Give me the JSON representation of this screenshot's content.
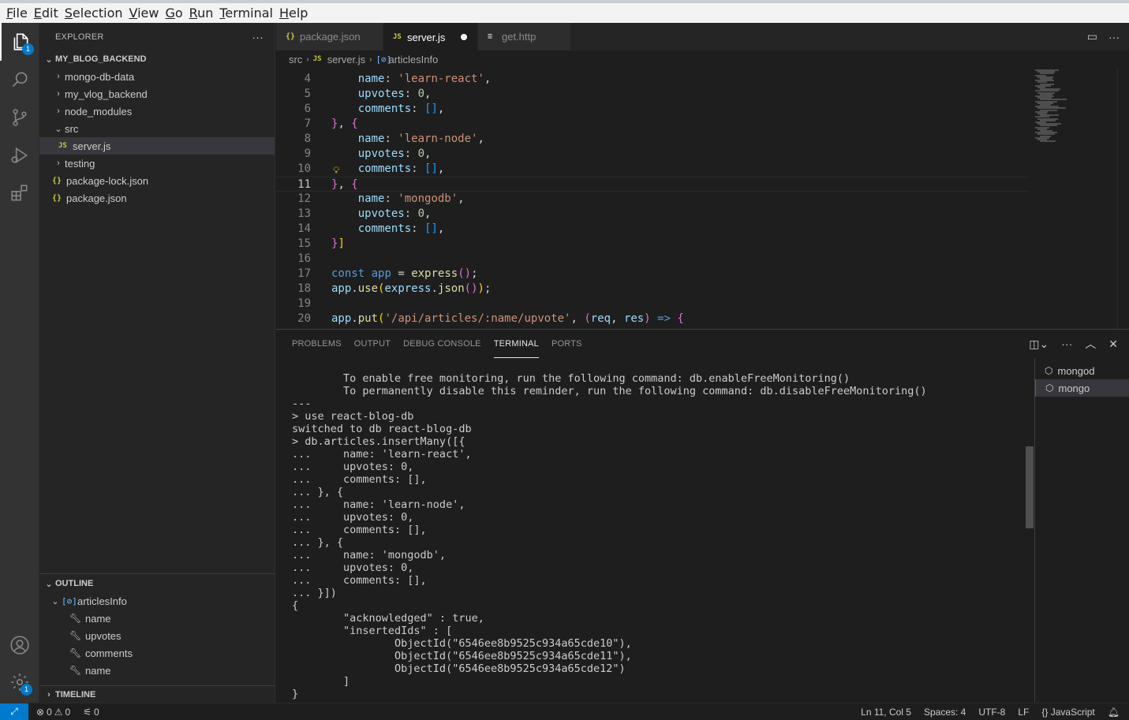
{
  "menu": [
    "File",
    "Edit",
    "Selection",
    "View",
    "Go",
    "Run",
    "Terminal",
    "Help"
  ],
  "activity": {
    "explorer_badge": "1",
    "settings_badge": "1"
  },
  "explorer": {
    "title": "EXPLORER",
    "more": "···",
    "root": "MY_BLOG_BACKEND",
    "items": [
      {
        "label": "mongo-db-data",
        "kind": "folder"
      },
      {
        "label": "my_vlog_backend",
        "kind": "folder"
      },
      {
        "label": "node_modules",
        "kind": "folder"
      },
      {
        "label": "src",
        "kind": "folder-open"
      },
      {
        "label": "server.js",
        "kind": "js"
      },
      {
        "label": "testing",
        "kind": "folder"
      },
      {
        "label": "package-lock.json",
        "kind": "json"
      },
      {
        "label": "package.json",
        "kind": "json"
      }
    ]
  },
  "outline": {
    "title": "OUTLINE",
    "root": "articlesInfo",
    "items": [
      "name",
      "upvotes",
      "comments",
      "name"
    ]
  },
  "timeline": {
    "title": "TIMELINE"
  },
  "tabs": [
    {
      "label": "package.json",
      "icon": "{}"
    },
    {
      "label": "server.js",
      "icon": "JS"
    },
    {
      "label": "get.http",
      "icon": "≡"
    }
  ],
  "breadcrumb": {
    "folder": "src",
    "file": "server.js",
    "symbol": "articlesInfo",
    "file_icon": "JS",
    "symbol_icon": "[⊘]"
  },
  "editor": {
    "lines": [
      {
        "n": "4",
        "html": "    <span class='p'>name</span>: <span class='s'>'learn-react'</span>,"
      },
      {
        "n": "5",
        "html": "    <span class='p'>upvotes</span>: <span class='n'>0</span>,"
      },
      {
        "n": "6",
        "html": "    <span class='p'>comments</span>: <span class='b2'>[]</span>,"
      },
      {
        "n": "7",
        "html": "<span class='b1'>}</span>, <span class='b1'>{</span>"
      },
      {
        "n": "8",
        "html": "    <span class='p'>name</span>: <span class='s'>'learn-node'</span>,"
      },
      {
        "n": "9",
        "html": "    <span class='p'>upvotes</span>: <span class='n'>0</span>,"
      },
      {
        "n": "10",
        "html": "    <span class='p'>comments</span>: <span class='b2'>[]</span>,"
      },
      {
        "n": "11",
        "html": "<span class='b1'>}</span>, <span class='b1'>{</span>"
      },
      {
        "n": "12",
        "html": "    <span class='p'>name</span>: <span class='s'>'mongodb'</span>,"
      },
      {
        "n": "13",
        "html": "    <span class='p'>upvotes</span>: <span class='n'>0</span>,"
      },
      {
        "n": "14",
        "html": "    <span class='p'>comments</span>: <span class='b2'>[]</span>,"
      },
      {
        "n": "15",
        "html": "<span class='b1'>}</span><span class='b3'>]</span>"
      },
      {
        "n": "16",
        "html": ""
      },
      {
        "n": "17",
        "html": "<span class='k'>const</span> <span class='k'>app</span> = <span class='f'>express</span><span class='b1'>()</span>;"
      },
      {
        "n": "18",
        "html": "<span class='p'>app</span>.<span class='f'>use</span><span class='b3'>(</span><span class='p'>express</span>.<span class='f'>json</span><span class='b1'>()</span><span class='b3'>)</span>;"
      },
      {
        "n": "19",
        "html": ""
      },
      {
        "n": "20",
        "html": "<span class='p'>app</span>.<span class='f'>put</span><span class='b3'>(</span><span class='s'>'/api/articles/:name/upvote'</span>, <span class='b1'>(</span><span class='p'>req</span>, <span class='p'>res</span><span class='b1'>)</span> <span class='k'>=&gt;</span> <span class='b1'>{</span>"
      }
    ],
    "current_line": "11"
  },
  "panel": {
    "tabs": [
      "PROBLEMS",
      "OUTPUT",
      "DEBUG CONSOLE",
      "TERMINAL",
      "PORTS"
    ],
    "active_tab": "TERMINAL",
    "terminal_lines": [
      "        To enable free monitoring, run the following command: db.enableFreeMonitoring()",
      "        To permanently disable this reminder, run the following command: db.disableFreeMonitoring()",
      "---",
      "> use react-blog-db",
      "switched to db react-blog-db",
      "> db.articles.insertMany([{",
      "...     name: 'learn-react',",
      "...     upvotes: 0,",
      "...     comments: [],",
      "... }, {",
      "...     name: 'learn-node',",
      "...     upvotes: 0,",
      "...     comments: [],",
      "... }, {",
      "...     name: 'mongodb',",
      "...     upvotes: 0,",
      "...     comments: [],",
      "... }])",
      "{",
      "        \"acknowledged\" : true,",
      "        \"insertedIds\" : [",
      "                ObjectId(\"6546ee8b9525c934a65cde10\"),",
      "                ObjectId(\"6546ee8b9525c934a65cde11\"),",
      "                ObjectId(\"6546ee8b9525c934a65cde12\")",
      "        ]",
      "}"
    ],
    "terminals": [
      "mongod",
      "mongo"
    ]
  },
  "status": {
    "errors": "0",
    "warnings": "0",
    "ports": "0",
    "position": "Ln 11, Col 5",
    "spaces": "Spaces: 4",
    "encoding": "UTF-8",
    "eol": "LF",
    "language": "JavaScript"
  }
}
